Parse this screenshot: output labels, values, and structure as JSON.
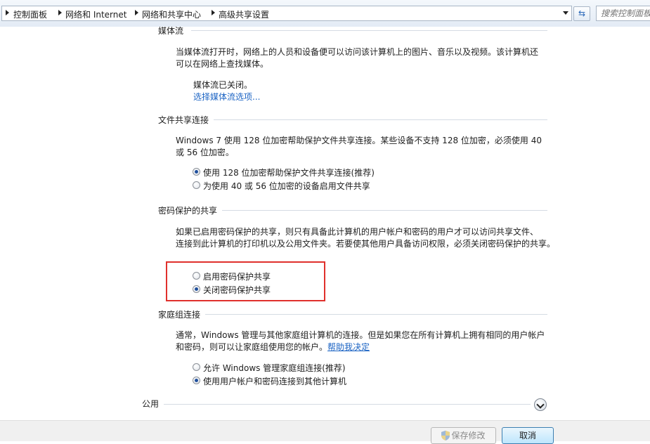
{
  "address_bar": {
    "crumbs": [
      "控制面板",
      "网络和 Internet",
      "网络和共享中心",
      "高级共享设置"
    ],
    "search_placeholder": "搜索控制面板",
    "refresh_icon": "refresh-icon"
  },
  "media": {
    "heading": "媒体流",
    "description_lines": [
      "当媒体流打开时，网络上的人员和设备便可以访问该计算机上的图片、音乐以及视频。该计算机还",
      "可以在网络上查找媒体。"
    ],
    "status": "媒体流已关闭。",
    "link": "选择媒体流选项..."
  },
  "file_sharing": {
    "heading": "文件共享连接",
    "description_lines": [
      "Windows 7 使用 128 位加密帮助保护文件共享连接。某些设备不支持 128 位加密，必须使用 40",
      "或 56 位加密。"
    ],
    "options": [
      {
        "label": "使用 128 位加密帮助保护文件共享连接(推荐)",
        "selected": true
      },
      {
        "label": "为使用 40 或 56 位加密的设备启用文件共享",
        "selected": false
      }
    ]
  },
  "password_sharing": {
    "heading": "密码保护的共享",
    "description_lines": [
      "如果已启用密码保护的共享，则只有具备此计算机的用户帐户和密码的用户才可以访问共享文件、",
      "连接到此计算机的打印机以及公用文件夹。若要使其他用户具备访问权限，必须关闭密码保护的共享。"
    ],
    "options": [
      {
        "label": "启用密码保护共享",
        "selected": false
      },
      {
        "label": "关闭密码保护共享",
        "selected": true
      }
    ],
    "highlight_color": "#e0302c"
  },
  "homegroup": {
    "heading": "家庭组连接",
    "description_lines": [
      "通常，Windows 管理与其他家庭组计算机的连接。但是如果您在所有计算机上拥有相同的用户帐户",
      "和密码，则可以让家庭组使用您的帐户。"
    ],
    "help_link": "帮助我决定",
    "options": [
      {
        "label": "允许 Windows 管理家庭组连接(推荐)",
        "selected": false
      },
      {
        "label": "使用用户帐户和密码连接到其他计算机",
        "selected": true
      }
    ]
  },
  "public_section": {
    "heading": "公用",
    "expand_icon": "chevron-down-icon"
  },
  "footer": {
    "save_label": "保存修改",
    "cancel_label": "取消"
  },
  "colors": {
    "link": "#1c64c4",
    "radio_dot": "#1f4f9c"
  }
}
